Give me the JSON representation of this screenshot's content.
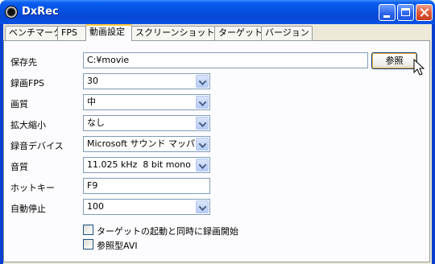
{
  "window": {
    "title": "DxRec"
  },
  "tabs": [
    {
      "label": "ベンチマーク"
    },
    {
      "label": "FPS"
    },
    {
      "label": "動画設定"
    },
    {
      "label": "スクリーンショット"
    },
    {
      "label": "ターゲット"
    },
    {
      "label": "バージョン"
    }
  ],
  "active_tab": "動画設定",
  "form": {
    "save_path": {
      "label": "保存先",
      "value": "C:¥movie",
      "button": "参照"
    },
    "fps": {
      "label": "録画FPS",
      "value": "30"
    },
    "quality": {
      "label": "画質",
      "value": "中"
    },
    "scale": {
      "label": "拡大縮小",
      "value": "なし"
    },
    "audio_device": {
      "label": "録音デバイス",
      "value": "Microsoft サウンド マッパー"
    },
    "audio_quality": {
      "label": "音質",
      "value": "11.025 kHz  8 bit mono"
    },
    "hotkey": {
      "label": "ホットキー",
      "value": "F9"
    },
    "auto_stop": {
      "label": "自動停止",
      "value": "100"
    }
  },
  "checkboxes": {
    "sync_target": {
      "label": "ターゲットの起動と同時に録画開始",
      "checked": false
    },
    "reference_avi": {
      "label": "参照型AVI",
      "checked": false
    }
  },
  "colors": {
    "titlebar": "#0550e0",
    "client": "#ece9d8",
    "panel": "#fcfcfe",
    "active_tab_accent": "#ffc83c"
  },
  "icons": {
    "app": "film-reel-icon",
    "dropdown": "chevron-down-icon",
    "cursor": "mouse-pointer-icon"
  }
}
